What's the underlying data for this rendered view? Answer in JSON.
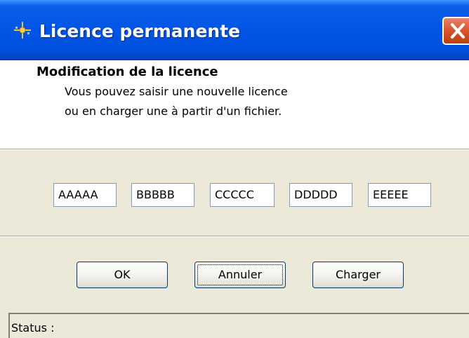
{
  "window": {
    "title": "Licence permanente",
    "icon": "sparkle-app-icon"
  },
  "header": {
    "title": "Modification de la licence",
    "lines": [
      "Vous pouvez saisir une nouvelle licence",
      "ou en charger une à partir d'un fichier."
    ]
  },
  "license_fields": [
    "AAAAA",
    "BBBBB",
    "CCCCC",
    "DDDDD",
    "EEEEE"
  ],
  "buttons": {
    "ok": "OK",
    "cancel": "Annuler",
    "load": "Charger"
  },
  "status": {
    "label": "Status :"
  },
  "colors": {
    "titlebar": "#0055e5",
    "close_button": "#d8582f",
    "window_face": "#ece9d8"
  }
}
